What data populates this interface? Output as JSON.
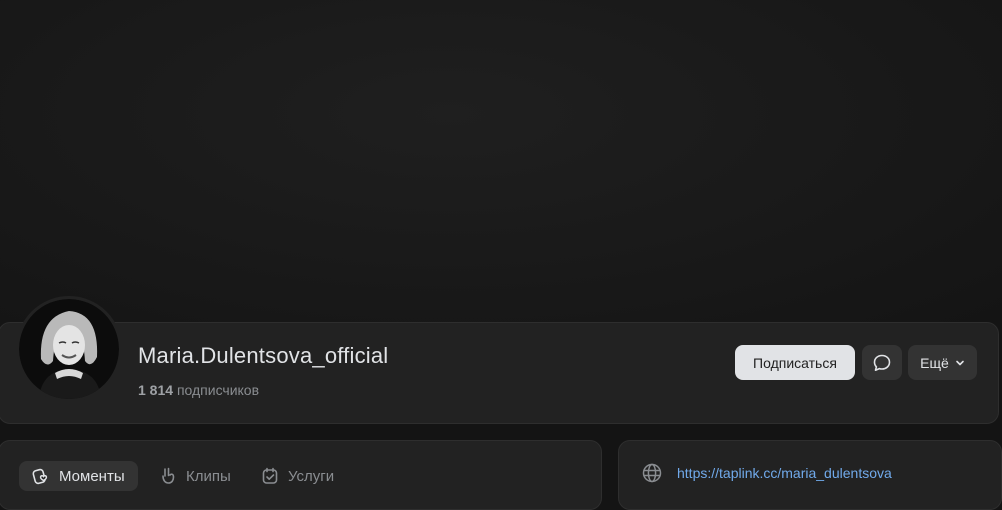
{
  "profile": {
    "name": "Maria.Dulentsova_official",
    "subscribers_count": "1 814",
    "subscribers_label": "подписчиков"
  },
  "actions": {
    "subscribe_label": "Подписаться",
    "message_icon": "chat-bubble-icon",
    "more_label": "Ещё",
    "more_icon": "chevron-down-icon"
  },
  "tabs": [
    {
      "label": "Моменты",
      "icon": "moments-icon",
      "active": true
    },
    {
      "label": "Клипы",
      "icon": "clips-icon",
      "active": false
    },
    {
      "label": "Услуги",
      "icon": "services-icon",
      "active": false
    }
  ],
  "info": {
    "website_icon": "globe-icon",
    "website": "https://taplink.cc/maria_dulentsova"
  },
  "colors": {
    "background": "#141414",
    "card": "#222222",
    "accent_link": "#71aaeb",
    "primary_button": "#e1e3e6"
  }
}
